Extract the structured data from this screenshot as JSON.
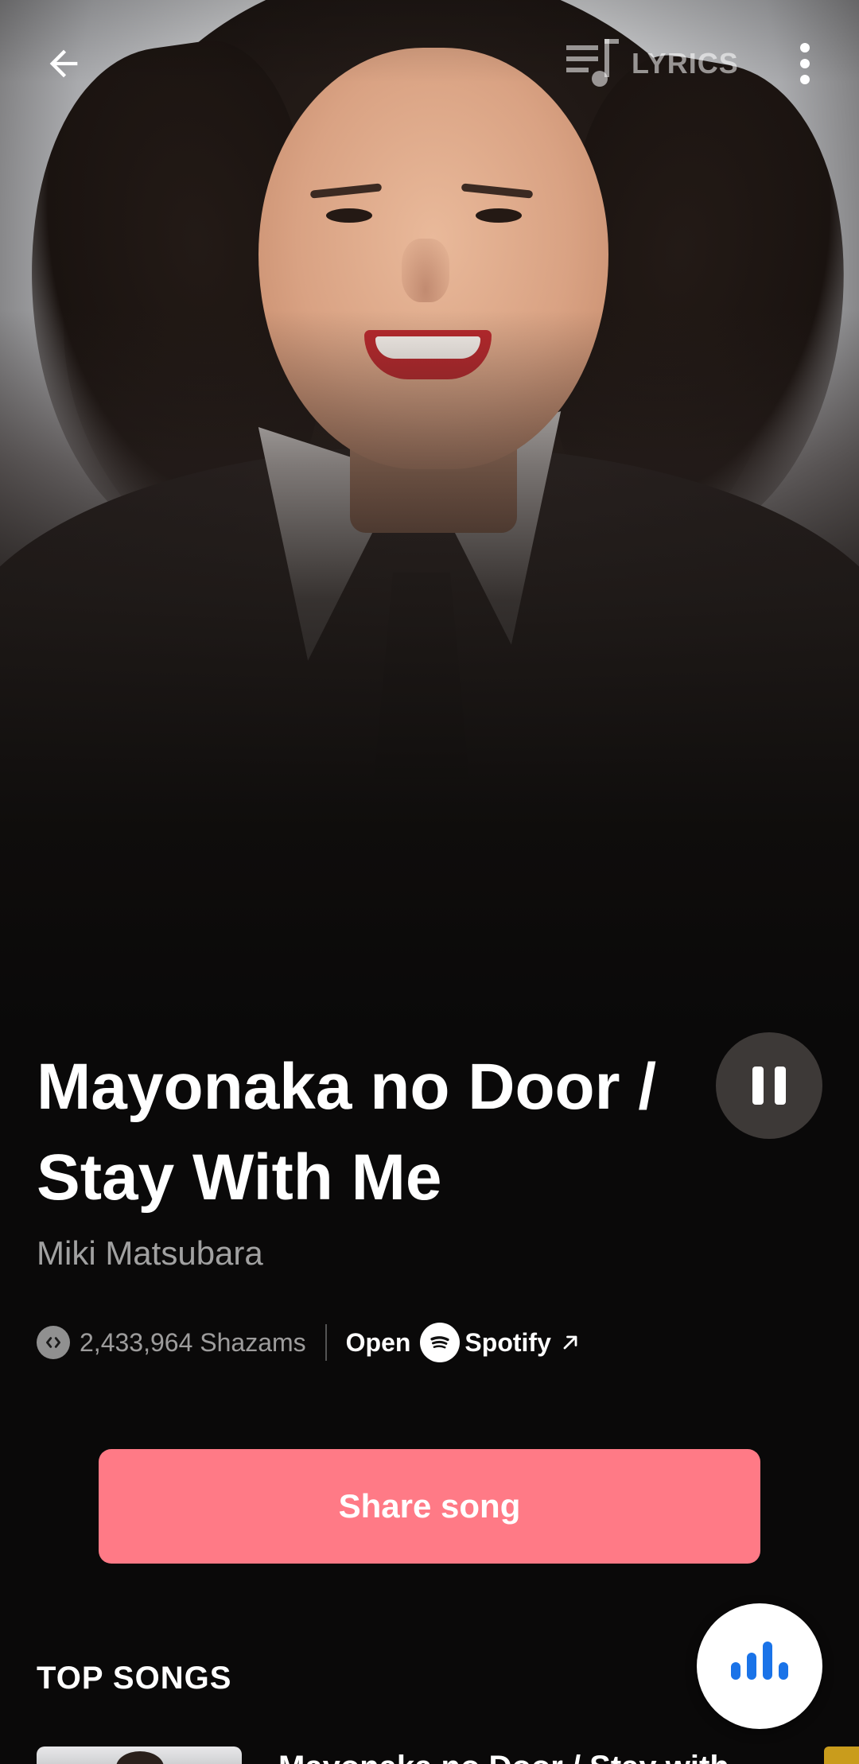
{
  "topbar": {
    "back_icon": "arrow-left-icon",
    "lyrics_label": "LYRICS",
    "lyrics_icon": "lyrics-list-music-icon",
    "more_icon": "more-vertical-icon"
  },
  "song": {
    "title": "Mayonaka no Door / Stay With Me",
    "artist": "Miki Matsubara",
    "is_playing": true,
    "play_state_icon": "pause-icon"
  },
  "stats": {
    "shazam_count": "2,433,964 Shazams",
    "shazam_icon": "shazam-logo-icon",
    "open_label": "Open",
    "provider": "Spotify",
    "provider_icon": "spotify-logo-icon",
    "external_icon": "external-link-arrow-icon"
  },
  "actions": {
    "share_label": "Share song"
  },
  "top_songs": {
    "heading": "TOP SONGS",
    "items": [
      {
        "title": "Mayonaka no Door / Stay with"
      }
    ]
  },
  "fab": {
    "icon": "shazam-listen-bars-icon"
  },
  "colors": {
    "accent": "#ff7a86",
    "background": "#0a0909",
    "fab_icon": "#1a73e8"
  }
}
